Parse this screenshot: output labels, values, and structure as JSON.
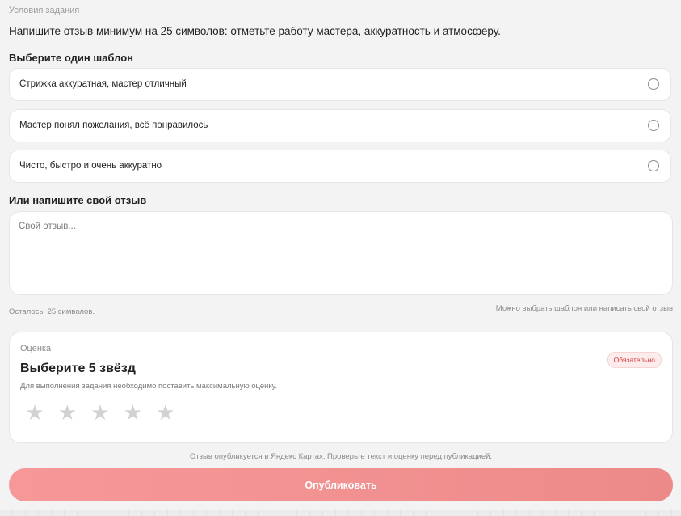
{
  "conditions": {
    "label": "Условия задания",
    "text": "Напишите отзыв минимум на 25 символов: отметьте работу мастера, аккуратность и атмосферу."
  },
  "templates": {
    "title": "Выберите один шаблон",
    "options": [
      {
        "label": "Стрижка аккуратная, мастер отличный"
      },
      {
        "label": "Мастер понял пожелания, всё понравилось"
      },
      {
        "label": "Чисто, быстро и очень аккуратно"
      }
    ]
  },
  "custom_review": {
    "title": "Или напишите свой отзыв",
    "placeholder": "Свой отзыв...",
    "value": "",
    "remaining": "Осталось: 25 символов.",
    "hint": "Можно выбрать шаблон или написать свой отзыв"
  },
  "rating": {
    "label": "Оценка",
    "title": "Выберите 5 звёзд",
    "description": "Для выполнения задания необходимо поставить максимальную оценку.",
    "badge": "Обязательно",
    "star_glyph": "★",
    "stars_total": 5,
    "stars_selected": 0
  },
  "publish": {
    "note": "Отзыв опубликуется в Яндекс Картах. Проверьте текст и оценку перед публикацией.",
    "button_label": "Опубликовать"
  }
}
